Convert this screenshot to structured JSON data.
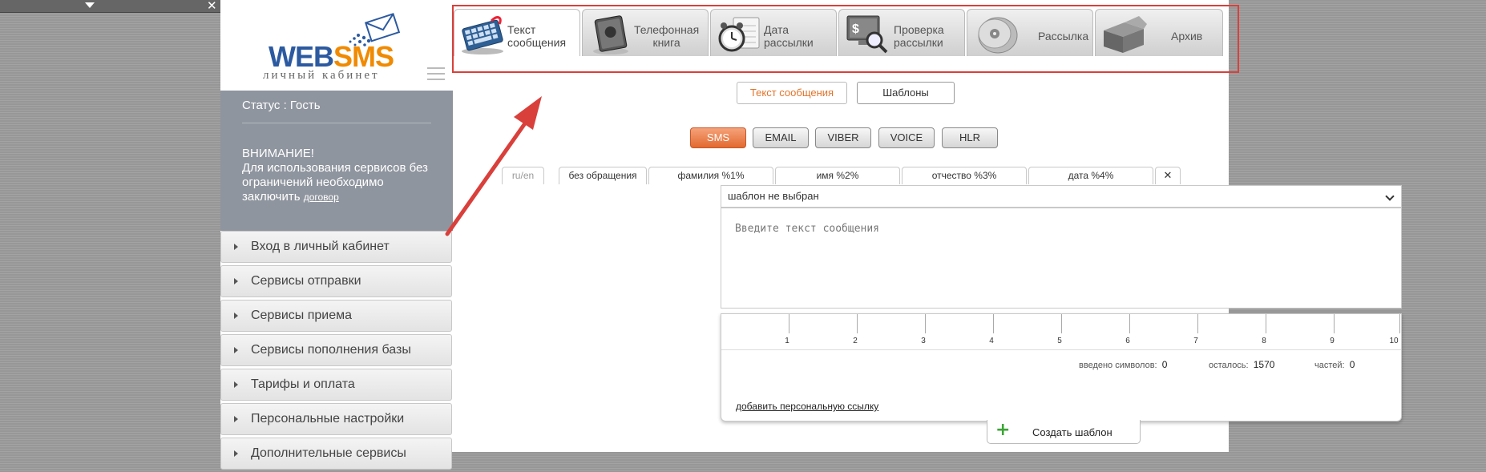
{
  "window": {
    "close_glyph": "✕"
  },
  "logo": {
    "brand_web": "WEB",
    "brand_sms": "SMS",
    "subtitle": "личный кабинет"
  },
  "sidebar": {
    "status": "Статус : Гость",
    "warning_title": "ВНИМАНИЕ!",
    "warning_text": "Для использования сервисов без ограничений необходимо заключить",
    "warning_link": "договор",
    "menu": [
      {
        "label": "Вход в личный кабинет"
      },
      {
        "label": "Сервисы отправки"
      },
      {
        "label": "Сервисы приема"
      },
      {
        "label": "Сервисы пополнения базы"
      },
      {
        "label": "Тарифы и оплата"
      },
      {
        "label": "Персональные настройки"
      },
      {
        "label": "Дополнительные сервисы"
      }
    ]
  },
  "tabs": [
    {
      "line1": "Текст",
      "line2": "сообщения",
      "icon": "keyboard-icon"
    },
    {
      "line1": "Телефонная",
      "line2": "книга",
      "icon": "phonebook-icon"
    },
    {
      "line1": "Дата",
      "line2": "рассылки",
      "icon": "clock-calendar-icon"
    },
    {
      "line1": "Проверка",
      "line2": "рассылки",
      "icon": "magnifier-icon"
    },
    {
      "line1": "Рассылка",
      "line2": "",
      "icon": "disc-icon"
    },
    {
      "line1": "Архив",
      "line2": "",
      "icon": "archive-box-icon"
    }
  ],
  "subtabs": {
    "message_text": "Текст сообщения",
    "templates": "Шаблоны"
  },
  "channels": [
    "SMS",
    "EMAIL",
    "VIBER",
    "VOICE",
    "HLR"
  ],
  "personalization": {
    "lang": "ru/en",
    "tabs": [
      "без обращения",
      "фамилия %1%",
      "имя %2%",
      "отчество %3%",
      "дата %4%"
    ],
    "close_glyph": "✕"
  },
  "template_select": {
    "value": "шаблон не выбран"
  },
  "message": {
    "placeholder": "Введите текст сообщения"
  },
  "ruler": {
    "ticks": [
      "1",
      "2",
      "3",
      "4",
      "5",
      "6",
      "7",
      "8",
      "9",
      "10"
    ]
  },
  "counters": {
    "entered_label": "введено символов:",
    "entered_value": "0",
    "left_label": "осталось:",
    "left_value": "1570",
    "parts_label": "частей:",
    "parts_value": "0"
  },
  "personal_link": "добавить персональную ссылку",
  "create_template": {
    "plus": "+",
    "label": "Создать шаблон"
  },
  "colors": {
    "accent_orange": "#e2692f",
    "highlight_red": "#d9403b",
    "brand_blue": "#2c5aa0"
  }
}
